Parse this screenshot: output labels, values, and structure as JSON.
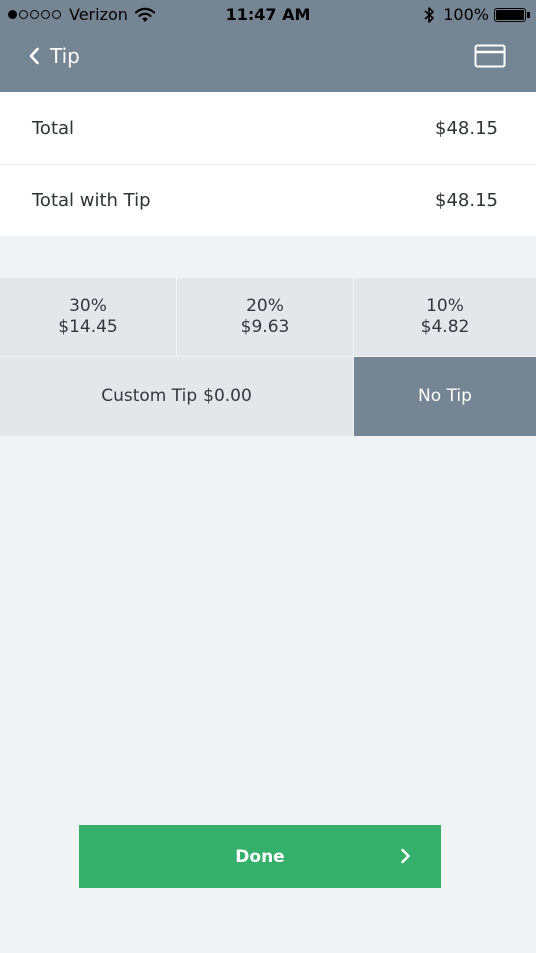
{
  "status_bar": {
    "carrier": "Verizon",
    "time": "11:47 AM",
    "battery": "100%",
    "signal_icon": "signal-dots-icon",
    "wifi_icon": "wifi-icon",
    "bluetooth_icon": "bluetooth-icon",
    "battery_icon": "battery-icon"
  },
  "nav": {
    "title": "Tip",
    "back_icon": "chevron-left-icon",
    "card_icon": "credit-card-icon"
  },
  "totals": {
    "total_label": "Total",
    "total_value": "$48.15",
    "total_with_tip_label": "Total with Tip",
    "total_with_tip_value": "$48.15"
  },
  "tip_options": [
    {
      "percent": "30%",
      "amount": "$14.45"
    },
    {
      "percent": "20%",
      "amount": "$9.63"
    },
    {
      "percent": "10%",
      "amount": "$4.82"
    }
  ],
  "custom_tip": {
    "label": "Custom Tip",
    "amount": "$0.00"
  },
  "no_tip": {
    "label": "No Tip",
    "selected": true
  },
  "done_button": {
    "label": "Done",
    "icon": "chevron-right-icon"
  },
  "colors": {
    "header_bg": "#758593",
    "selected_bg": "#758593",
    "option_bg": "#e3e7ea",
    "accent_green": "#35b06a",
    "page_bg": "#f1f2f4"
  }
}
